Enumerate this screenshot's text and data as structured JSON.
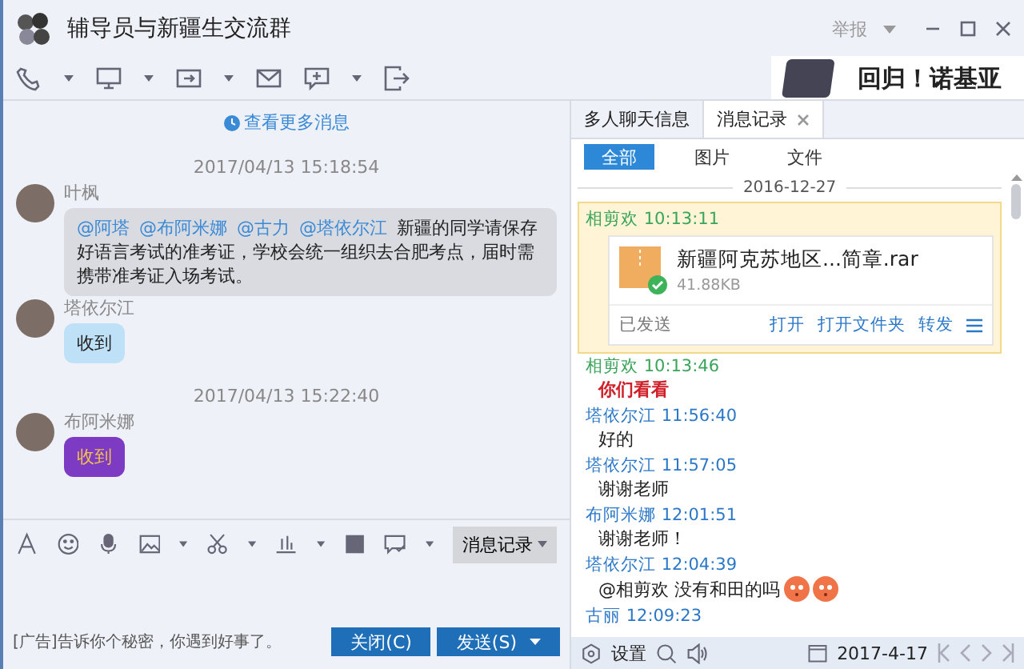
{
  "window": {
    "title": "辅导员与新疆生交流群",
    "report": "举报"
  },
  "ad_banner": {
    "text": "回归！诺基亚"
  },
  "chat": {
    "more_messages": "查看更多消息",
    "items": [
      {
        "kind": "timestamp",
        "text": "2017/04/13 15:18:54"
      },
      {
        "kind": "message",
        "sender": "叶枫",
        "color": "#d9dbe0",
        "mentions": [
          "@阿塔",
          "@布阿米娜",
          "@古力",
          "@塔依尔江"
        ],
        "text": "新疆的同学请保存好语言考试的准考证，学校会统一组织去合肥考点，届时需携带准考证入场考试。"
      },
      {
        "kind": "message",
        "sender": "塔依尔江",
        "color": "#bfe1f8",
        "text": "收到"
      },
      {
        "kind": "timestamp",
        "text": "2017/04/13 15:22:40"
      },
      {
        "kind": "message",
        "sender": "布阿米娜",
        "color": "#7d3bc4",
        "text": "收到"
      }
    ]
  },
  "input_toolbar": {
    "history_button": "消息记录"
  },
  "footer": {
    "ad": "[广告]告诉你个秘密，你遇到好事了。",
    "close_button": "关闭(C)",
    "send_button": "发送(S)"
  },
  "side_panel": {
    "tabs": [
      {
        "label": "多人聊天信息",
        "selected": false,
        "closable": false
      },
      {
        "label": "消息记录",
        "selected": true,
        "closable": true
      }
    ],
    "filters": [
      {
        "label": "全部",
        "selected": true
      },
      {
        "label": "图片",
        "selected": false
      },
      {
        "label": "文件",
        "selected": false
      }
    ],
    "date": "2016-12-27",
    "records": [
      {
        "kind": "file",
        "sender": "相剪欢",
        "self": true,
        "time": "10:13:11",
        "selected": true,
        "file_name": "新疆阿克苏地区...简章.rar",
        "size": "41.88KB",
        "status": "已发送",
        "actions": [
          "打开",
          "打开文件夹",
          "转发"
        ]
      },
      {
        "kind": "text",
        "sender": "相剪欢",
        "self": true,
        "time": "10:13:46",
        "selected": false,
        "text": "你们看看",
        "emphasis": true
      },
      {
        "kind": "text",
        "sender": "塔依尔江",
        "self": false,
        "time": "11:56:40",
        "selected": false,
        "text": "好的",
        "emphasis": false
      },
      {
        "kind": "text",
        "sender": "塔依尔江",
        "self": false,
        "time": "11:57:05",
        "selected": false,
        "text": "谢谢老师",
        "emphasis": false
      },
      {
        "kind": "text",
        "sender": "布阿米娜",
        "self": false,
        "time": "12:01:51",
        "selected": false,
        "text": "谢谢老师！",
        "emphasis": false
      },
      {
        "kind": "text",
        "sender": "塔依尔江",
        "self": false,
        "time": "12:04:39",
        "selected": false,
        "text": "@相剪欢  没有和田的吗",
        "emphasis": false,
        "emojis": [
          {
            "kind": "blushing"
          },
          {
            "kind": "blushing"
          }
        ]
      },
      {
        "kind": "header",
        "sender": "古丽",
        "self": false,
        "time": "12:09:23",
        "selected": false
      }
    ],
    "bottom_bar": {
      "settings": "设置",
      "date": "2017-4-17"
    }
  }
}
